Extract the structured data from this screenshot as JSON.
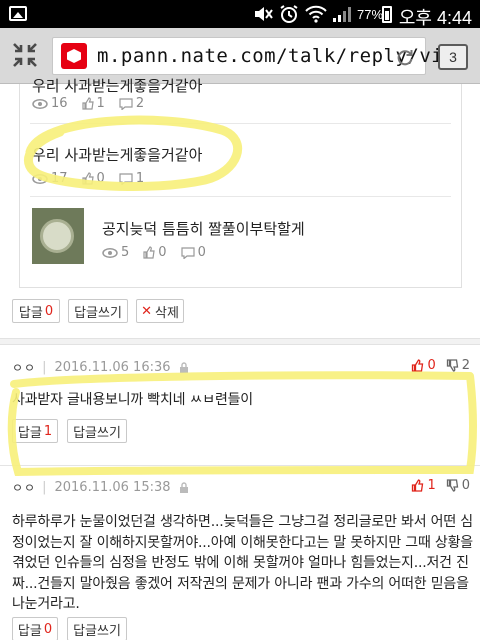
{
  "status_bar": {
    "battery_text": "77%",
    "time": "오후 4:44",
    "icons": [
      "gallery-icon",
      "mute-icon",
      "alarm-icon",
      "wifi-icon",
      "signal-icon",
      "battery-icon"
    ]
  },
  "browser": {
    "url": "m.pann.nate.com/talk/reply/view",
    "tab_count": "3",
    "icons": [
      "collapse-icon",
      "site-logo-icon",
      "reload-icon"
    ]
  },
  "related_posts": [
    {
      "title": "우리 사과받는게좋을거같아",
      "views": "16",
      "likes": "1",
      "comments": "2"
    },
    {
      "title": "우리 사과받는게좋을거같아",
      "views": "17",
      "likes": "0",
      "comments": "1"
    },
    {
      "title": "공지늦덕 틈틈히 짤풀이부탁할게",
      "views": "5",
      "likes": "0",
      "comments": "0"
    }
  ],
  "post_actions": {
    "reply_label": "답글",
    "reply_count": "0",
    "write_reply_label": "답글쓰기",
    "delete_label": "삭제"
  },
  "comments": [
    {
      "nickname": "ㅇㅇ",
      "date": "2016.11.06 16:36",
      "upvotes": "0",
      "downvotes": "2",
      "body": "사과받자 글내용보니까 빡치네 ㅆㅂ련들이",
      "reply_label": "답글",
      "reply_count": "1",
      "write_reply_label": "답글쓰기"
    },
    {
      "nickname": "ㅇㅇ",
      "date": "2016.11.06 15:38",
      "upvotes": "1",
      "downvotes": "0",
      "body_lines": [
        "하루하루가 눈물이었던걸 생각하면...늦덕들은 그냥그걸 정리글로만 봐서 어떤 심",
        "정이었는지 잘 이해하지못할꺼야...아예 이해못한다고는 말 못하지만 그때 상황을",
        "겪었던 인슈들의 심정을 반정도 밖에 이해 못할꺼야 얼마나 힘들었는지...저건 진",
        "짜...건들지 말아줬음 좋겠어 저작권의 문제가 아니라 팬과 가수의 어떠한 믿음을",
        "나눈거라고."
      ],
      "reply_label": "답글",
      "reply_count": "0",
      "write_reply_label": "답글쓰기"
    }
  ],
  "colors": {
    "accent_red": "#e0241b",
    "highlighter": "#f7ef7a",
    "status_bar": "#000000",
    "browser_bar": "#d9d9d9"
  }
}
